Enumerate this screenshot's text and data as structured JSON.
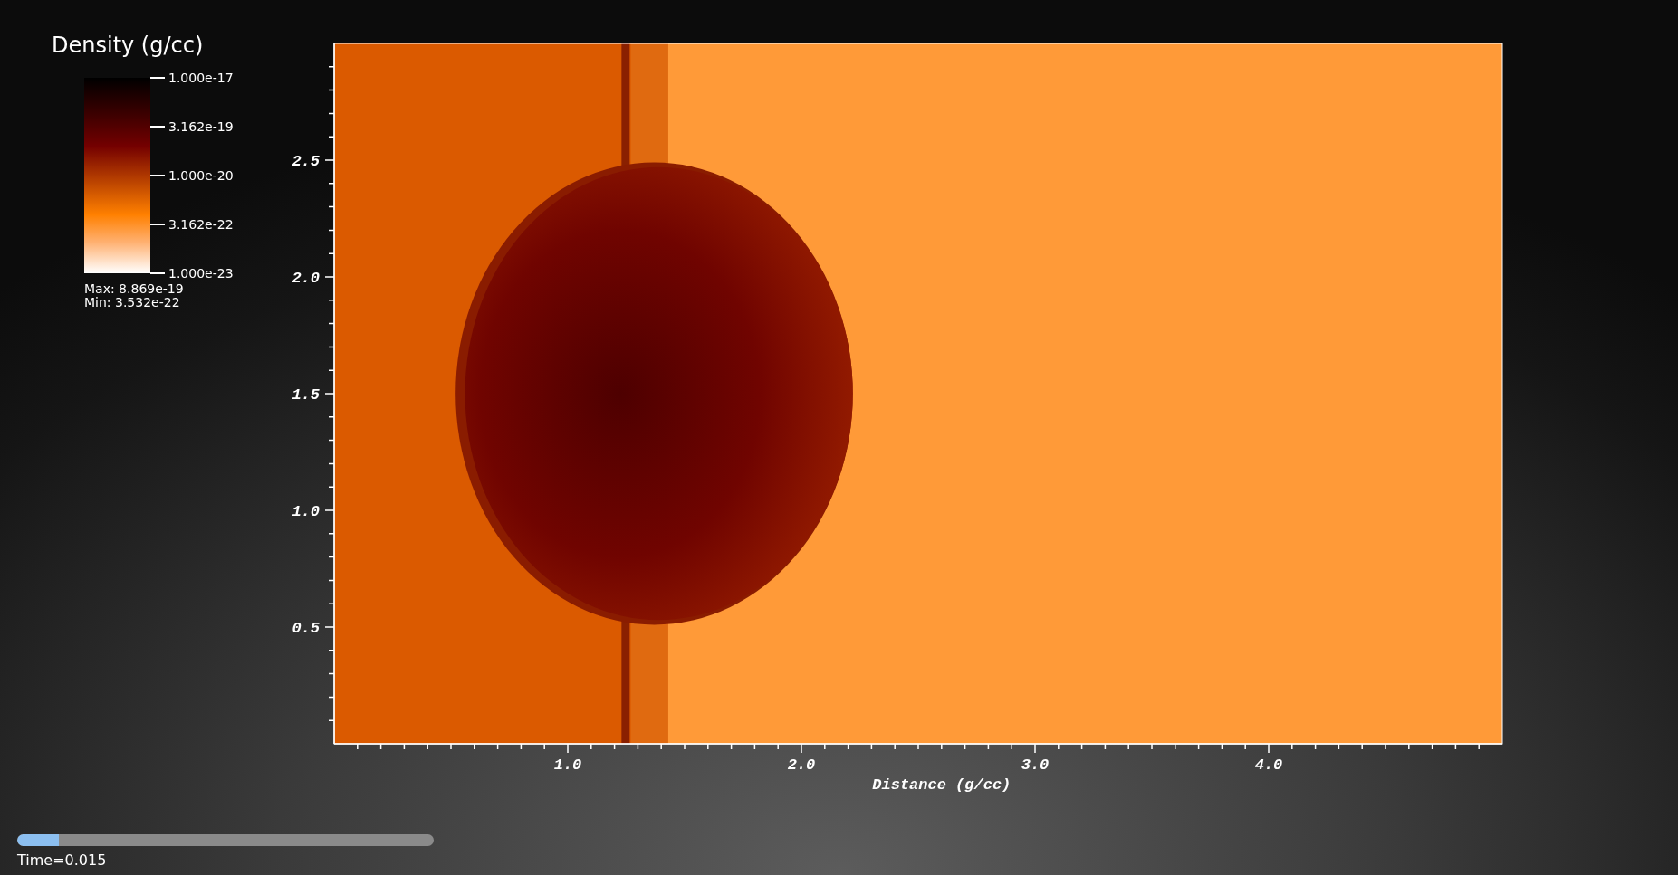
{
  "legend": {
    "title": "Density (g/cc)",
    "ticks": [
      "1.000e-17",
      "3.162e-19",
      "1.000e-20",
      "3.162e-22",
      "1.000e-23"
    ],
    "max": "Max:  8.869e-19",
    "min": "Min:  3.532e-22"
  },
  "plot": {
    "x_axis": {
      "title": "Distance (g/cc)",
      "ticks": [
        "1.0",
        "2.0",
        "3.0",
        "4.0"
      ]
    },
    "y_axis": {
      "ticks": [
        "2.5",
        "2.0",
        "1.5",
        "1.0",
        "0.5"
      ]
    }
  },
  "time_slider": {
    "level": 0.1,
    "label": "Time=0.015"
  }
}
